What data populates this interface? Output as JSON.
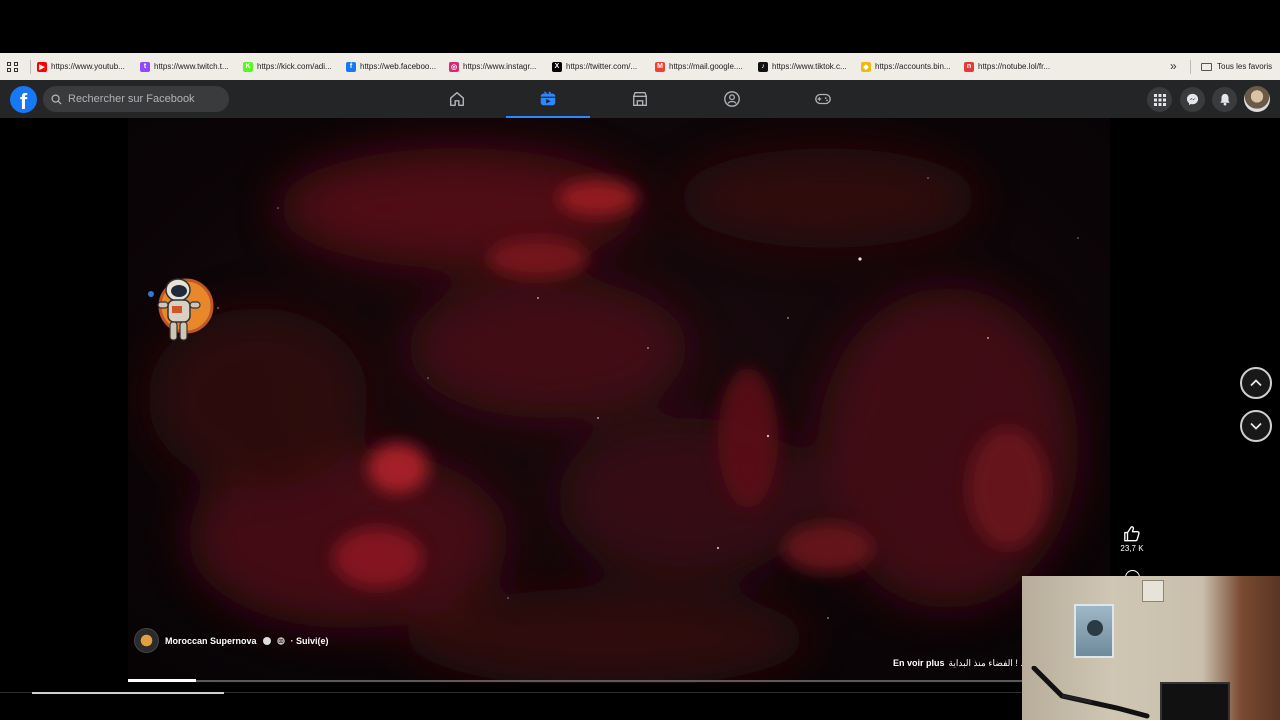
{
  "bookmarks": {
    "items": [
      {
        "label": "https://www.youtub...",
        "icon": "youtube-icon",
        "color": "#ff0000",
        "glyph": "▶"
      },
      {
        "label": "https://www.twitch.t...",
        "icon": "twitch-icon",
        "color": "#9146ff",
        "glyph": "t"
      },
      {
        "label": "https://kick.com/adi...",
        "icon": "kick-icon",
        "color": "#53fc18",
        "glyph": "K"
      },
      {
        "label": "https://web.faceboo...",
        "icon": "facebook-icon",
        "color": "#1877f2",
        "glyph": "f"
      },
      {
        "label": "https://www.instagr...",
        "icon": "instagram-icon",
        "color": "#d62976",
        "glyph": "◎"
      },
      {
        "label": "https://twitter.com/...",
        "icon": "x-icon",
        "color": "#000000",
        "glyph": "X"
      },
      {
        "label": "https://mail.google....",
        "icon": "gmail-icon",
        "color": "#ea4335",
        "glyph": "M"
      },
      {
        "label": "https://www.tiktok.c...",
        "icon": "tiktok-icon",
        "color": "#111111",
        "glyph": "♪"
      },
      {
        "label": "https://accounts.bin...",
        "icon": "binance-icon",
        "color": "#f0b90b",
        "glyph": "◆"
      },
      {
        "label": "https://notube.lol/fr...",
        "icon": "notube-icon",
        "color": "#e03a3a",
        "glyph": "n"
      }
    ],
    "more": "»",
    "all_favorites": "Tous les favoris"
  },
  "header": {
    "search_placeholder": "Rechercher sur Facebook",
    "tabs": [
      {
        "icon": "home-icon",
        "active": false
      },
      {
        "icon": "video-icon",
        "active": true
      },
      {
        "icon": "marketplace-icon",
        "active": false
      },
      {
        "icon": "groups-icon",
        "active": false
      },
      {
        "icon": "gaming-icon",
        "active": false
      }
    ],
    "accent_color": "#2d88ff"
  },
  "video": {
    "author": "Moroccan Supernova",
    "follow_status": "· Suivi(e)",
    "caption_text": "الفضاء منذ البداية ! ...",
    "see_more": "En voir plus",
    "likes": "23,7 K",
    "progress_fraction": 0.076
  }
}
